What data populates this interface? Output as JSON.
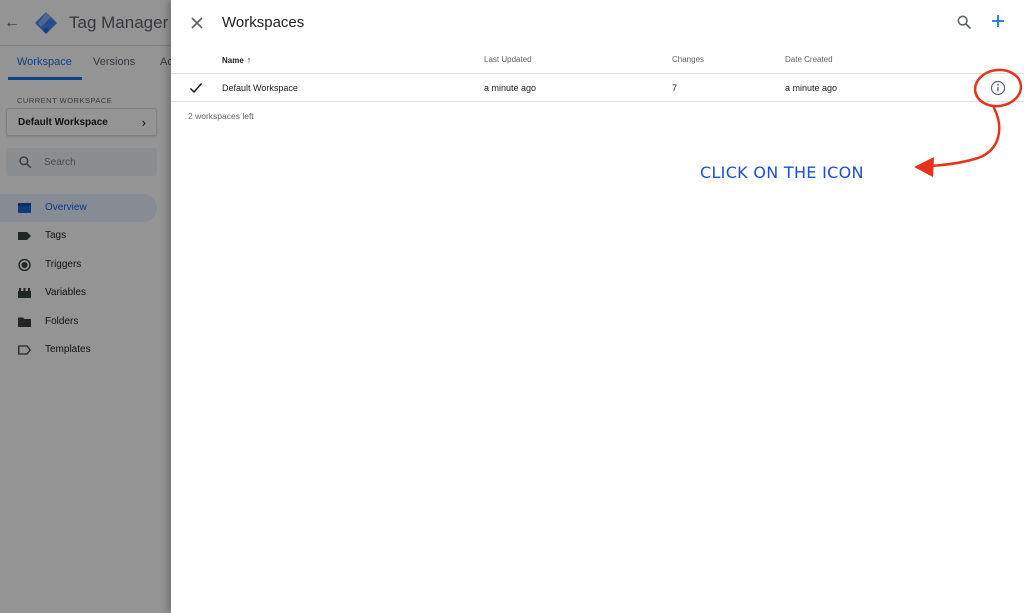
{
  "app": {
    "title": "Tag Manager"
  },
  "nav_tabs": [
    {
      "label": "Workspace",
      "active": true
    },
    {
      "label": "Versions",
      "active": false
    },
    {
      "label": "Ac",
      "active": false
    }
  ],
  "sidebar": {
    "current_workspace_label": "CURRENT WORKSPACE",
    "current_workspace_name": "Default Workspace",
    "search_placeholder": "Search",
    "items": [
      {
        "label": "Overview",
        "icon": "overview-icon",
        "active": true
      },
      {
        "label": "Tags",
        "icon": "tag-icon",
        "active": false
      },
      {
        "label": "Triggers",
        "icon": "trigger-icon",
        "active": false
      },
      {
        "label": "Variables",
        "icon": "variables-icon",
        "active": false
      },
      {
        "label": "Folders",
        "icon": "folder-icon",
        "active": false
      },
      {
        "label": "Templates",
        "icon": "template-icon",
        "active": false
      }
    ]
  },
  "panel": {
    "title": "Workspaces",
    "columns": {
      "name": "Name",
      "last_updated": "Last Updated",
      "changes": "Changes",
      "date_created": "Date Created"
    },
    "rows": [
      {
        "selected": true,
        "name": "Default Workspace",
        "last_updated": "a minute ago",
        "changes": "7",
        "date_created": "a minute ago"
      }
    ],
    "remaining_text": "2 workspaces left"
  },
  "annotation": {
    "text": "CLICK ON THE ICON",
    "color": "#e8321c"
  },
  "colors": {
    "accent": "#1a73e8",
    "annotation_text": "#1a4fd8",
    "annotation_stroke": "#e8321c"
  }
}
